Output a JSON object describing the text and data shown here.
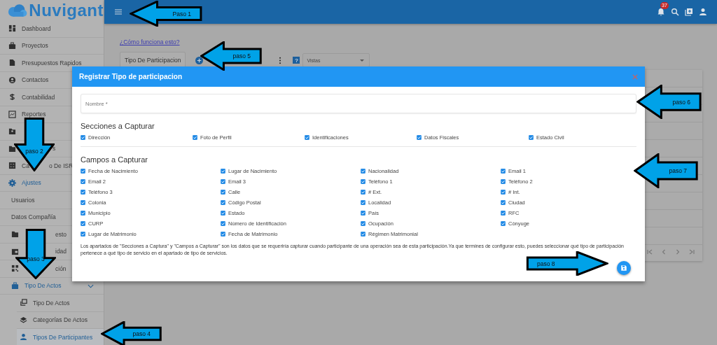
{
  "app": {
    "logo": "Nuvigant"
  },
  "sidebar": {
    "items": [
      {
        "label": "Dashboard",
        "selected": false
      },
      {
        "label": "Proyectos",
        "selected": false
      },
      {
        "label": "Presupuestos Rapidos",
        "selected": false
      },
      {
        "label": "Contactos",
        "selected": false
      },
      {
        "label": "Contabilidad",
        "selected": false
      },
      {
        "label": "Reportes",
        "selected": false
      },
      {
        "selected": false
      },
      {
        "label": "s",
        "selected": false
      },
      {
        "label": "Ca",
        "tail": "o De ISR",
        "selected": false
      },
      {
        "label": "Ajustes",
        "selected": false,
        "children": [
          {
            "label": "Usuarios",
            "selected": false
          },
          {
            "label": "Datos Compañía",
            "selected": false
          },
          {
            "label": "esto",
            "selected": false
          },
          {
            "label": "idad",
            "selected": false
          },
          {
            "label": "ción",
            "selected": false
          },
          {
            "label": "Tipo De Actos",
            "selected": false,
            "expanded": true,
            "children": [
              {
                "label": "Tipo De Actos",
                "selected": false
              },
              {
                "label": "Categorías De Actos",
                "selected": false
              },
              {
                "label": "Tipos De Participantes",
                "selected": true
              }
            ]
          }
        ]
      }
    ]
  },
  "top_bar": {
    "notifications": "37"
  },
  "page": {
    "help_link": "¿Cómo funciona esto?",
    "tab": "Tipo De Participacion",
    "help_icon": "?",
    "views_select": {
      "placeholder": "Vistas"
    }
  },
  "dialog": {
    "title": "Registrar Tipo de participacion",
    "name_field": {
      "placeholder": "Nombre *"
    },
    "sections_title": "Secciones a Capturar",
    "sections": [
      {
        "label": "Dirección",
        "checked": true
      },
      {
        "label": "Foto de Perfil",
        "checked": true
      },
      {
        "label": "Identificaciones",
        "checked": true
      },
      {
        "label": "Datos Fiscales",
        "checked": true
      },
      {
        "label": "Estado Civil",
        "checked": true
      }
    ],
    "fields_title": "Campos a Capturar",
    "fields": [
      {
        "label": "Fecha de Nacimiento",
        "checked": true
      },
      {
        "label": "Lugar de Nacimiento",
        "checked": true
      },
      {
        "label": "Nacionalidad",
        "checked": true
      },
      {
        "label": "Email 1",
        "checked": true
      },
      {
        "label": "Email 2",
        "checked": true
      },
      {
        "label": "Email 3",
        "checked": true
      },
      {
        "label": "Teléfono 1",
        "checked": true
      },
      {
        "label": "Teléfono 2",
        "checked": true
      },
      {
        "label": "Teléfono 3",
        "checked": true
      },
      {
        "label": "Calle",
        "checked": true
      },
      {
        "label": "# Ext.",
        "checked": true
      },
      {
        "label": "# Int.",
        "checked": true
      },
      {
        "label": "Colonia",
        "checked": true
      },
      {
        "label": "Código Postal",
        "checked": true
      },
      {
        "label": "Localidad",
        "checked": true
      },
      {
        "label": "Ciudad",
        "checked": true
      },
      {
        "label": "Municipio",
        "checked": true
      },
      {
        "label": "Estado",
        "checked": true
      },
      {
        "label": "País",
        "checked": true
      },
      {
        "label": "RFC",
        "checked": true
      },
      {
        "label": "CURP",
        "checked": true
      },
      {
        "label": "Número de Identificación",
        "checked": true
      },
      {
        "label": "Ocupación",
        "checked": true
      },
      {
        "label": "Cónyuge",
        "checked": true
      },
      {
        "label": "Lugar de Matrimonio",
        "checked": true
      },
      {
        "label": "Fecha de Matrimonio",
        "checked": true
      },
      {
        "label": "Régimen Matrimonial",
        "checked": true
      }
    ],
    "note": "Los apartados de \"Secciones a Captura\" y \"Campos a Capturar\" son los datos que se requeriría capturar cuando participante de una operación sea de esta participación.Ya que termines de configurar esto, puedes seleccionar qué tipo de participación pertenece a qué tipo de servicio en el apartado de tipo de servicios."
  },
  "annotations": [
    {
      "label": "Paso 1"
    },
    {
      "label": "paso 5"
    },
    {
      "label": "paso 6"
    },
    {
      "label": "paso 7"
    },
    {
      "label": "paso 2"
    },
    {
      "label": "paso 3"
    },
    {
      "label": "paso 4"
    },
    {
      "label": "paso 8"
    }
  ]
}
